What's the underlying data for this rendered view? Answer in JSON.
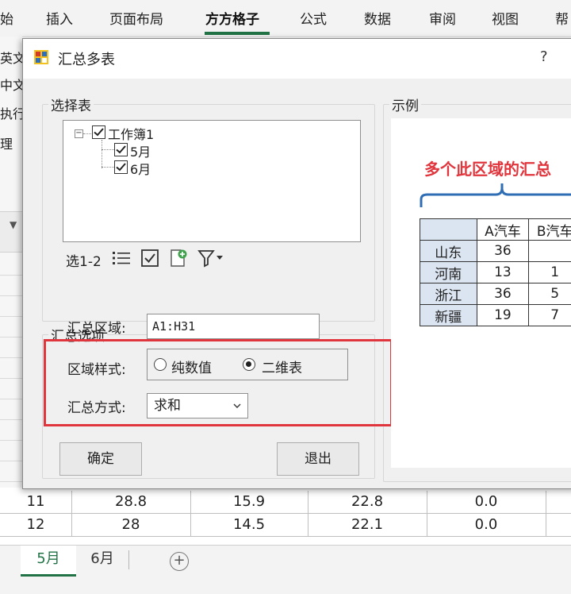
{
  "ribbon": {
    "tabs": [
      "始",
      "插入",
      "页面布局",
      "方方格子",
      "公式",
      "数据",
      "审阅",
      "视图",
      "帮"
    ],
    "active_tab": "方方格子",
    "accent_color": "#217346"
  },
  "left_panel": {
    "items": [
      "英文",
      "中文",
      "执行",
      "理"
    ]
  },
  "grid": {
    "rows": [
      [
        "11",
        "28.8",
        "15.9",
        "22.8",
        "0.0"
      ],
      [
        "12",
        "28",
        "14.5",
        "22.1",
        "0.0"
      ]
    ]
  },
  "sheets": {
    "tabs": [
      "5月",
      "6月"
    ],
    "active": "5月",
    "add_icon": "plus-circle-icon"
  },
  "dialog": {
    "title": "汇总多表",
    "help": "?",
    "select_table": {
      "label": "选择表",
      "tree": {
        "root": "工作簿1",
        "children": [
          "5月",
          "6月"
        ]
      },
      "toolbar": {
        "label": "选1-2",
        "icons": [
          "list-icon",
          "check-all-icon",
          "add-sheet-icon",
          "filter-icon"
        ]
      }
    },
    "options": {
      "label": "汇总选项",
      "range_label": "汇总区域:",
      "range_value": "A1:H31",
      "style_label": "区域样式:",
      "style_options": [
        "纯数值",
        "二维表"
      ],
      "style_selected": "二维表",
      "method_label": "汇总方式:",
      "method_value": "求和",
      "highlight_color": "#e0353c"
    },
    "buttons": {
      "ok": "确定",
      "exit": "退出"
    },
    "example": {
      "label": "示例",
      "title": "多个此区域的汇总",
      "title_color": "#e0353c",
      "header": [
        "",
        "A汽车",
        "B汽车"
      ],
      "rows": [
        [
          "山东",
          "36",
          ""
        ],
        [
          "河南",
          "13",
          "1"
        ],
        [
          "浙江",
          "36",
          "5"
        ],
        [
          "新疆",
          "19",
          "7"
        ]
      ]
    }
  }
}
